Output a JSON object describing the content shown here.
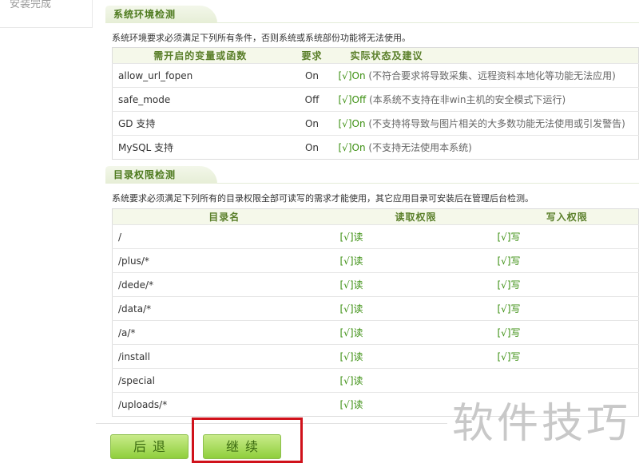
{
  "sidebar": {
    "last_step": "安装完成"
  },
  "env": {
    "title": "系统环境检测",
    "desc": "系统环境要求必须满足下列所有条件，否则系统或系统部份功能将无法使用。",
    "headers": [
      "需开启的变量或函数",
      "要求",
      "实际状态及建议"
    ],
    "rows": [
      {
        "name": "allow_url_fopen",
        "req": "On",
        "status": "[√]On",
        "note": "(不符合要求将导致采集、远程资料本地化等功能无法应用)"
      },
      {
        "name": "safe_mode",
        "req": "Off",
        "status": "[√]Off",
        "note": "(本系统不支持在非win主机的安全模式下运行)"
      },
      {
        "name": "GD 支持",
        "req": "On",
        "status": "[√]On",
        "note": "(不支持将导致与图片相关的大多数功能无法使用或引发警告)"
      },
      {
        "name": "MySQL 支持",
        "req": "On",
        "status": "[√]On",
        "note": "(不支持无法使用本系统)"
      }
    ]
  },
  "dirs": {
    "title": "目录权限检测",
    "desc": "系统要求必须满足下列所有的目录权限全部可读写的需求才能使用，其它应用目录可安装后在管理后台检测。",
    "headers": [
      "目录名",
      "读取权限",
      "写入权限"
    ],
    "rows": [
      {
        "name": "/",
        "read": "[√]读",
        "write": "[√]写"
      },
      {
        "name": "/plus/*",
        "read": "[√]读",
        "write": "[√]写"
      },
      {
        "name": "/dede/*",
        "read": "[√]读",
        "write": "[√]写"
      },
      {
        "name": "/data/*",
        "read": "[√]读",
        "write": "[√]写"
      },
      {
        "name": "/a/*",
        "read": "[√]读",
        "write": "[√]写"
      },
      {
        "name": "/install",
        "read": "[√]读",
        "write": "[√]写"
      },
      {
        "name": "/special",
        "read": "[√]读",
        "write": ""
      },
      {
        "name": "/uploads/*",
        "read": "[√]读",
        "write": ""
      }
    ]
  },
  "buttons": {
    "back": "后退",
    "continue": "继续"
  },
  "watermark": "软件技巧"
}
